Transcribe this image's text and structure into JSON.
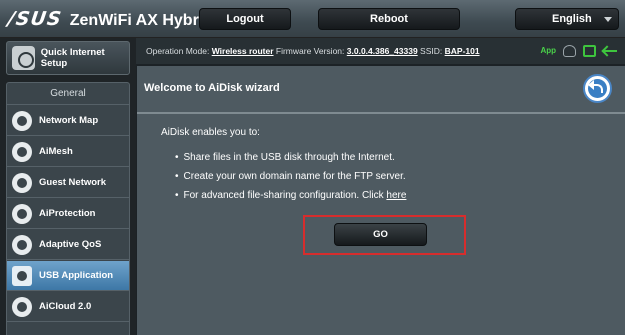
{
  "header": {
    "brand": "/SUS",
    "product": "ZenWiFi AX Hybrid",
    "logout_label": "Logout",
    "reboot_label": "Reboot",
    "language": "English"
  },
  "status": {
    "operation_mode_label": "Operation Mode:",
    "operation_mode": "Wireless router",
    "firmware_label": "Firmware Version:",
    "firmware": "3.0.0.4.386_43339",
    "ssid_label": "SSID:",
    "ssid": "BAP-101",
    "app_label": "App",
    "icons": [
      "user-icon",
      "usb-icon",
      "network-icon"
    ]
  },
  "sidebar": {
    "quick_setup": "Quick Internet Setup",
    "section_title": "General",
    "items": [
      {
        "label": "Network Map",
        "icon": "network-map-icon"
      },
      {
        "label": "AiMesh",
        "icon": "aimesh-icon"
      },
      {
        "label": "Guest Network",
        "icon": "guest-network-icon"
      },
      {
        "label": "AiProtection",
        "icon": "aiprotection-icon"
      },
      {
        "label": "Adaptive QoS",
        "icon": "adaptive-qos-icon"
      },
      {
        "label": "USB Application",
        "icon": "usb-application-icon",
        "active": true
      },
      {
        "label": "AiCloud 2.0",
        "icon": "aicloud-icon"
      }
    ]
  },
  "main": {
    "title": "Welcome to AiDisk wizard",
    "intro": "AiDisk enables you to:",
    "bullets": [
      "Share files in the USB disk through the Internet.",
      "Create your own domain name for the FTP server."
    ],
    "bullet3_text": "For advanced file-sharing configuration. Click",
    "bullet3_link": "here",
    "go_label": "GO"
  },
  "colors": {
    "highlight_border": "#d72d2d",
    "active_item": "#4f8bbb",
    "status_green": "#3ec53e"
  }
}
